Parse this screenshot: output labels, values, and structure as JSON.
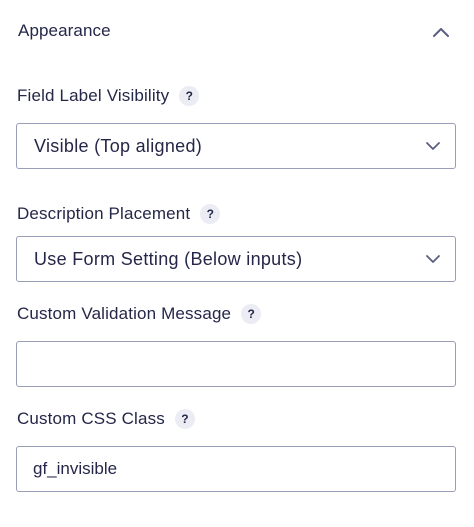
{
  "panel": {
    "title": "Appearance",
    "toggle_icon": "chevron-up-icon"
  },
  "fields": {
    "label_visibility": {
      "label": "Field Label Visibility",
      "help": "?",
      "selected": "Visible (Top aligned)"
    },
    "description_placement": {
      "label": "Description Placement",
      "help": "?",
      "selected": "Use Form Setting (Below inputs)"
    },
    "validation_message": {
      "label": "Custom Validation Message",
      "help": "?",
      "value": ""
    },
    "css_class": {
      "label": "Custom CSS Class",
      "help": "?",
      "value": "gf_invisible"
    }
  },
  "colors": {
    "text": "#242748",
    "border": "#9b9eb8",
    "badge_bg": "#ebecf4",
    "chevron": "#5b5e80"
  }
}
